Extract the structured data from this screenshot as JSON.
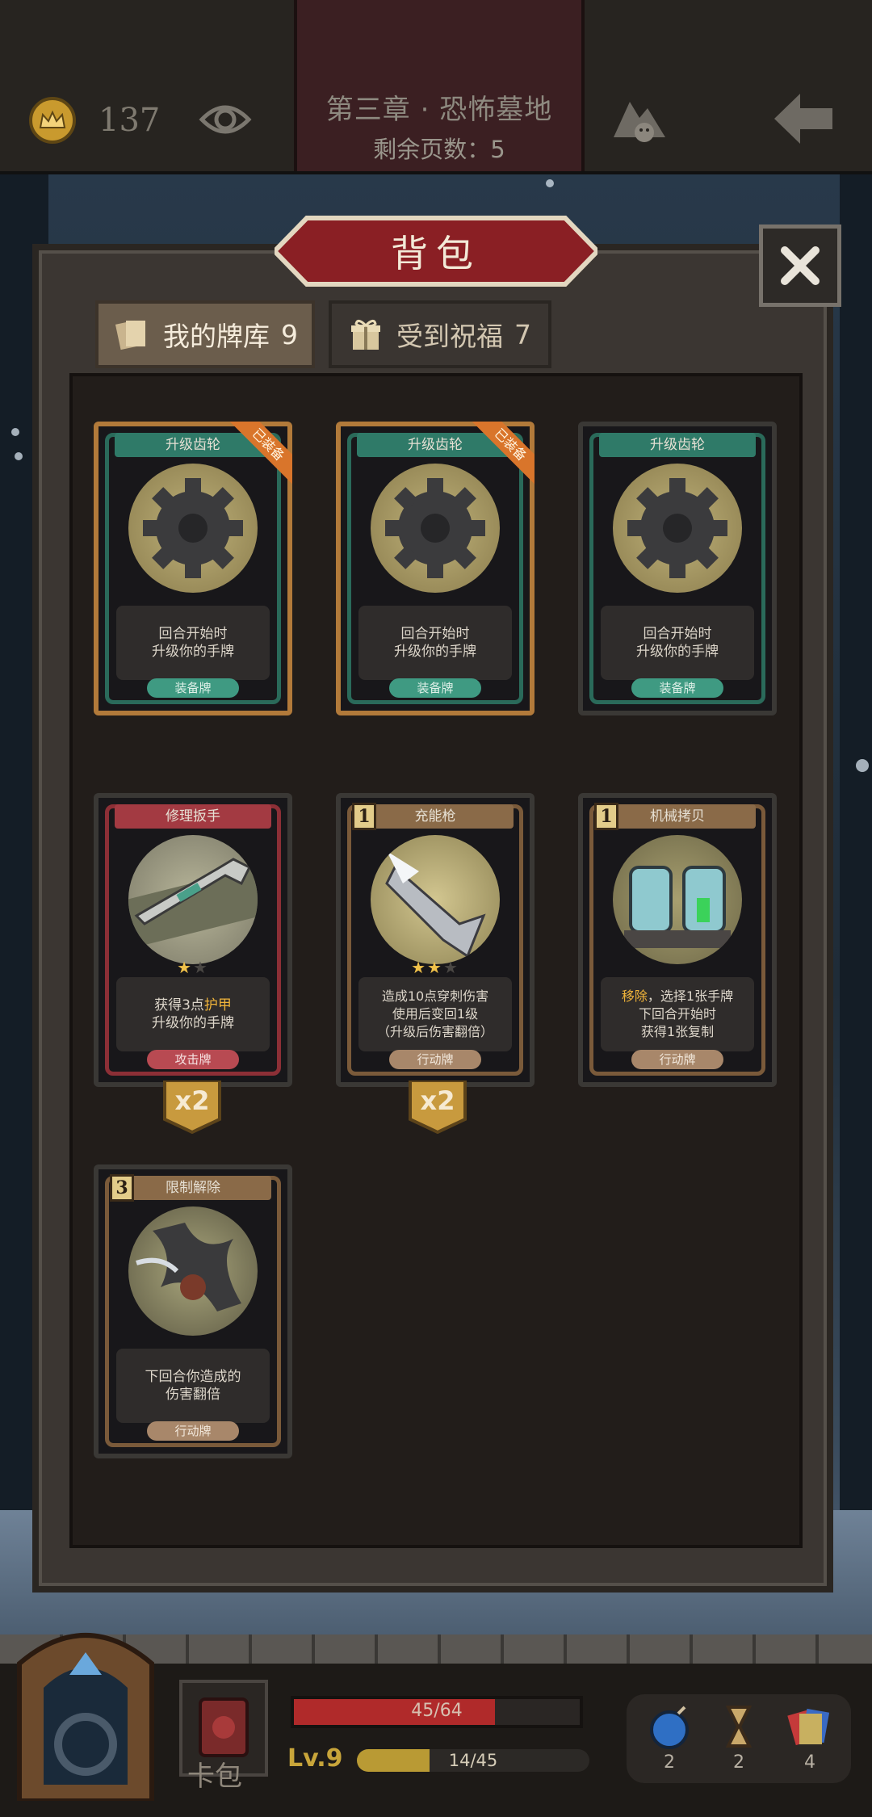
{
  "header": {
    "gold": "137",
    "chapter_title": "第三章 · 恐怖墓地",
    "pages_left": "剩余页数：5"
  },
  "panel": {
    "title": "背包",
    "tabs": [
      {
        "label": "我的牌库",
        "count": "9"
      },
      {
        "label": "受到祝福",
        "count": "7"
      }
    ]
  },
  "cards": [
    {
      "name": "升级齿轮",
      "desc1": "回合开始时",
      "desc2": "升级你的手牌",
      "type": "装备牌",
      "badge": "已装备"
    },
    {
      "name": "升级齿轮",
      "desc1": "回合开始时",
      "desc2": "升级你的手牌",
      "type": "装备牌",
      "badge": "已装备"
    },
    {
      "name": "升级齿轮",
      "desc1": "回合开始时",
      "desc2": "升级你的手牌",
      "type": "装备牌"
    },
    {
      "name": "修理扳手",
      "desc1a": "获得3点",
      "desc1b": "护甲",
      "desc2": "升级你的手牌",
      "type": "攻击牌",
      "multiplier": "x2",
      "stars": 1,
      "stars_max": 2
    },
    {
      "name": "充能枪",
      "cost": "1",
      "desc1": "造成10点穿刺伤害",
      "desc2": "使用后变回1级",
      "desc3": "（升级后伤害翻倍）",
      "type": "行动牌",
      "multiplier": "x2",
      "stars": 2,
      "stars_max": 3
    },
    {
      "name": "机械拷贝",
      "cost": "1",
      "desc1a": "移除",
      "desc1b": "，选择1张手牌",
      "desc2": "下回合开始时",
      "desc3": "获得1张复制",
      "type": "行动牌"
    },
    {
      "name": "限制解除",
      "cost": "3",
      "desc1": "下回合你造成的",
      "desc2": "伤害翻倍",
      "type": "行动牌"
    }
  ],
  "bottom": {
    "pack_label": "卡包",
    "hp": "45/64",
    "hp_fraction": 0.703,
    "level": "Lv.9",
    "xp": "14/45",
    "xp_fraction": 0.311,
    "resources": [
      {
        "icon": "bomb-icon",
        "count": "2"
      },
      {
        "icon": "hourglass-icon",
        "count": "2"
      },
      {
        "icon": "cards-icon",
        "count": "4"
      }
    ]
  }
}
